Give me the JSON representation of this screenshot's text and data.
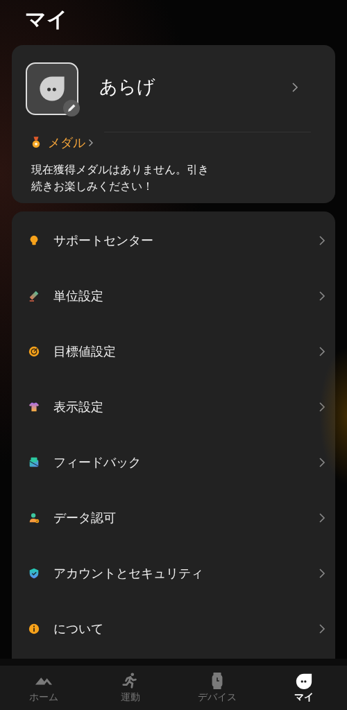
{
  "header": {
    "title": "マイ"
  },
  "profile": {
    "name": "あらげ",
    "medal_link": "メダル",
    "medal_message": "現在獲得メダルはありません。引き続きお楽しみください！"
  },
  "menu": [
    {
      "kind": "bulb",
      "label": "サポートセンター"
    },
    {
      "kind": "ruler",
      "label": "単位設定"
    },
    {
      "kind": "target",
      "label": "目標値設定"
    },
    {
      "kind": "shirt",
      "label": "表示設定"
    },
    {
      "kind": "mail",
      "label": "フィードバック"
    },
    {
      "kind": "person",
      "label": "データ認可"
    },
    {
      "kind": "shield",
      "label": "アカウントとセキュリティ"
    },
    {
      "kind": "info",
      "label": "について"
    }
  ],
  "tab_bar": [
    {
      "kind": "home",
      "label": "ホーム",
      "selected": false
    },
    {
      "kind": "run",
      "label": "運動",
      "selected": false
    },
    {
      "kind": "watch",
      "label": "デバイス",
      "selected": false
    },
    {
      "kind": "me",
      "label": "マイ",
      "selected": true
    }
  ]
}
